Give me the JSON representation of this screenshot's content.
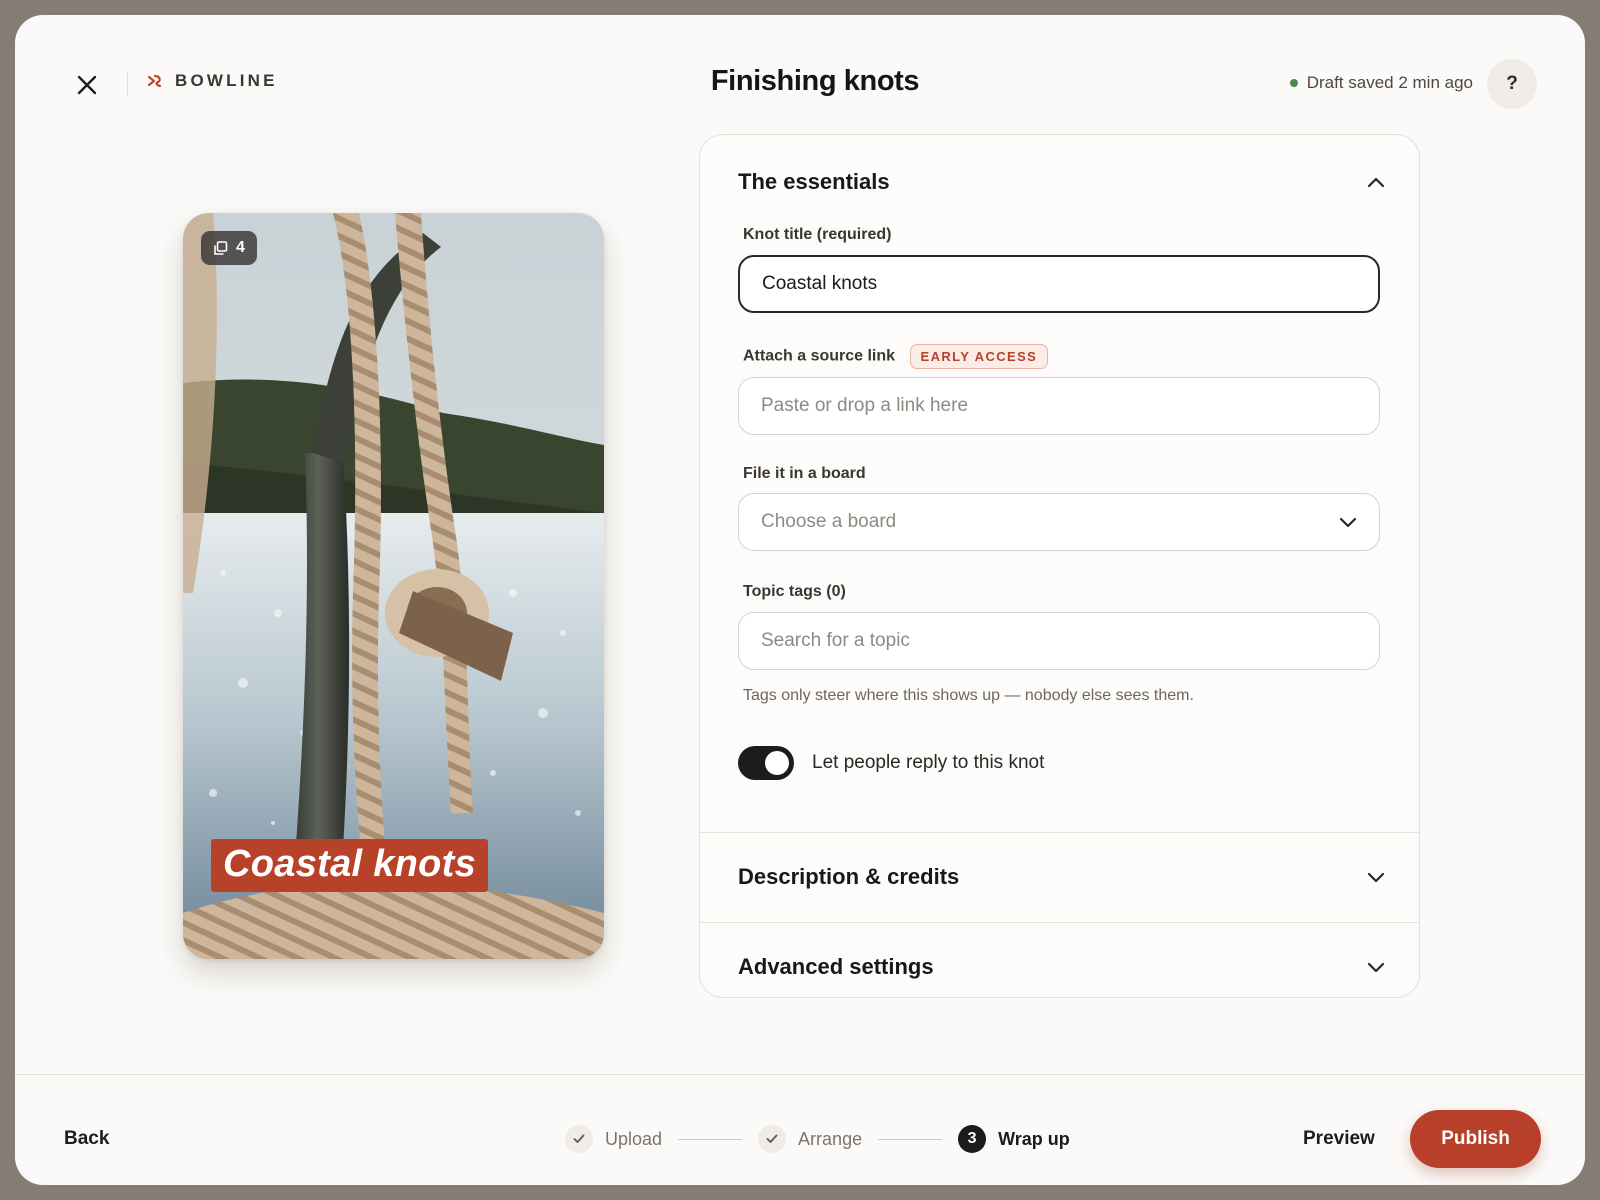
{
  "header": {
    "brand_name": "BOWLINE",
    "title": "Finishing knots",
    "draft_status": "Draft saved 2 min ago",
    "help_label": "?"
  },
  "preview": {
    "image_count": "4",
    "overlay_title": "Coastal knots"
  },
  "essentials": {
    "title": "The essentials",
    "knot_title_label": "Knot title (required)",
    "knot_title_value": "Coastal knots",
    "source_link_label": "Attach a source link",
    "early_access_badge": "EARLY ACCESS",
    "source_link_placeholder": "Paste or drop a link here",
    "board_label": "File it in a board",
    "board_placeholder": "Choose a board",
    "tags_label": "Topic tags (0)",
    "tags_placeholder": "Search for a topic",
    "tags_hint": "Tags only steer where this shows up — nobody else sees them.",
    "replies_toggle_label": "Let people reply to this knot",
    "replies_enabled": true
  },
  "sections": {
    "description_title": "Description & credits",
    "advanced_title": "Advanced settings"
  },
  "footer": {
    "back_label": "Back",
    "steps": [
      {
        "label": "Upload",
        "status": "done"
      },
      {
        "label": "Arrange",
        "status": "done"
      },
      {
        "label": "Wrap up",
        "status": "current",
        "number": "3"
      }
    ],
    "preview_label": "Preview",
    "publish_label": "Publish"
  },
  "colors": {
    "accent": "#b8402a",
    "status_dot": "#4f8a4c",
    "ink": "#1e1c1a"
  }
}
